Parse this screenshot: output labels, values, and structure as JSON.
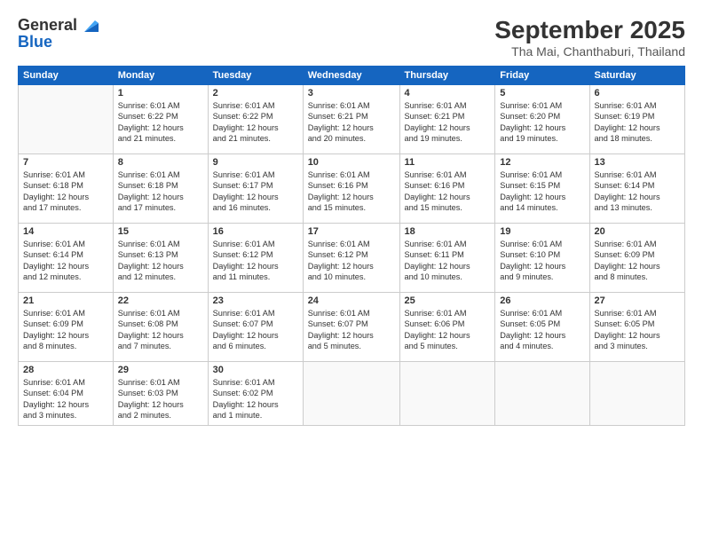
{
  "header": {
    "logo_line1": "General",
    "logo_line2": "Blue",
    "month": "September 2025",
    "location": "Tha Mai, Chanthaburi, Thailand"
  },
  "weekdays": [
    "Sunday",
    "Monday",
    "Tuesday",
    "Wednesday",
    "Thursday",
    "Friday",
    "Saturday"
  ],
  "weeks": [
    [
      {
        "num": "",
        "info": ""
      },
      {
        "num": "1",
        "info": "Sunrise: 6:01 AM\nSunset: 6:22 PM\nDaylight: 12 hours\nand 21 minutes."
      },
      {
        "num": "2",
        "info": "Sunrise: 6:01 AM\nSunset: 6:22 PM\nDaylight: 12 hours\nand 21 minutes."
      },
      {
        "num": "3",
        "info": "Sunrise: 6:01 AM\nSunset: 6:21 PM\nDaylight: 12 hours\nand 20 minutes."
      },
      {
        "num": "4",
        "info": "Sunrise: 6:01 AM\nSunset: 6:21 PM\nDaylight: 12 hours\nand 19 minutes."
      },
      {
        "num": "5",
        "info": "Sunrise: 6:01 AM\nSunset: 6:20 PM\nDaylight: 12 hours\nand 19 minutes."
      },
      {
        "num": "6",
        "info": "Sunrise: 6:01 AM\nSunset: 6:19 PM\nDaylight: 12 hours\nand 18 minutes."
      }
    ],
    [
      {
        "num": "7",
        "info": "Sunrise: 6:01 AM\nSunset: 6:18 PM\nDaylight: 12 hours\nand 17 minutes."
      },
      {
        "num": "8",
        "info": "Sunrise: 6:01 AM\nSunset: 6:18 PM\nDaylight: 12 hours\nand 17 minutes."
      },
      {
        "num": "9",
        "info": "Sunrise: 6:01 AM\nSunset: 6:17 PM\nDaylight: 12 hours\nand 16 minutes."
      },
      {
        "num": "10",
        "info": "Sunrise: 6:01 AM\nSunset: 6:16 PM\nDaylight: 12 hours\nand 15 minutes."
      },
      {
        "num": "11",
        "info": "Sunrise: 6:01 AM\nSunset: 6:16 PM\nDaylight: 12 hours\nand 15 minutes."
      },
      {
        "num": "12",
        "info": "Sunrise: 6:01 AM\nSunset: 6:15 PM\nDaylight: 12 hours\nand 14 minutes."
      },
      {
        "num": "13",
        "info": "Sunrise: 6:01 AM\nSunset: 6:14 PM\nDaylight: 12 hours\nand 13 minutes."
      }
    ],
    [
      {
        "num": "14",
        "info": "Sunrise: 6:01 AM\nSunset: 6:14 PM\nDaylight: 12 hours\nand 12 minutes."
      },
      {
        "num": "15",
        "info": "Sunrise: 6:01 AM\nSunset: 6:13 PM\nDaylight: 12 hours\nand 12 minutes."
      },
      {
        "num": "16",
        "info": "Sunrise: 6:01 AM\nSunset: 6:12 PM\nDaylight: 12 hours\nand 11 minutes."
      },
      {
        "num": "17",
        "info": "Sunrise: 6:01 AM\nSunset: 6:12 PM\nDaylight: 12 hours\nand 10 minutes."
      },
      {
        "num": "18",
        "info": "Sunrise: 6:01 AM\nSunset: 6:11 PM\nDaylight: 12 hours\nand 10 minutes."
      },
      {
        "num": "19",
        "info": "Sunrise: 6:01 AM\nSunset: 6:10 PM\nDaylight: 12 hours\nand 9 minutes."
      },
      {
        "num": "20",
        "info": "Sunrise: 6:01 AM\nSunset: 6:09 PM\nDaylight: 12 hours\nand 8 minutes."
      }
    ],
    [
      {
        "num": "21",
        "info": "Sunrise: 6:01 AM\nSunset: 6:09 PM\nDaylight: 12 hours\nand 8 minutes."
      },
      {
        "num": "22",
        "info": "Sunrise: 6:01 AM\nSunset: 6:08 PM\nDaylight: 12 hours\nand 7 minutes."
      },
      {
        "num": "23",
        "info": "Sunrise: 6:01 AM\nSunset: 6:07 PM\nDaylight: 12 hours\nand 6 minutes."
      },
      {
        "num": "24",
        "info": "Sunrise: 6:01 AM\nSunset: 6:07 PM\nDaylight: 12 hours\nand 5 minutes."
      },
      {
        "num": "25",
        "info": "Sunrise: 6:01 AM\nSunset: 6:06 PM\nDaylight: 12 hours\nand 5 minutes."
      },
      {
        "num": "26",
        "info": "Sunrise: 6:01 AM\nSunset: 6:05 PM\nDaylight: 12 hours\nand 4 minutes."
      },
      {
        "num": "27",
        "info": "Sunrise: 6:01 AM\nSunset: 6:05 PM\nDaylight: 12 hours\nand 3 minutes."
      }
    ],
    [
      {
        "num": "28",
        "info": "Sunrise: 6:01 AM\nSunset: 6:04 PM\nDaylight: 12 hours\nand 3 minutes."
      },
      {
        "num": "29",
        "info": "Sunrise: 6:01 AM\nSunset: 6:03 PM\nDaylight: 12 hours\nand 2 minutes."
      },
      {
        "num": "30",
        "info": "Sunrise: 6:01 AM\nSunset: 6:02 PM\nDaylight: 12 hours\nand 1 minute."
      },
      {
        "num": "",
        "info": ""
      },
      {
        "num": "",
        "info": ""
      },
      {
        "num": "",
        "info": ""
      },
      {
        "num": "",
        "info": ""
      }
    ]
  ]
}
